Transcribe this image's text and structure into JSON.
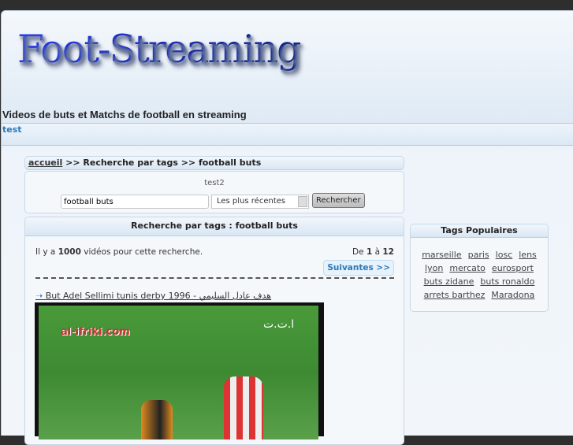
{
  "header": {
    "logo": "Foot-Streaming",
    "tagline": "Videos de buts et Matchs de football en streaming",
    "sub_link": "test"
  },
  "breadcrumb": {
    "home": "accueil",
    "rest": ">> Recherche par tags >> football buts"
  },
  "search": {
    "label": "test2",
    "query": "football buts",
    "sort": "Les plus récentes",
    "button": "Rechercher"
  },
  "results": {
    "title": "Recherche par tags : football buts",
    "count_prefix": "Il y a ",
    "count": "1000",
    "count_suffix": " vidéos pour cette recherche.",
    "range_prefix": "De ",
    "from": "1",
    "range_mid": " à ",
    "to": "12",
    "next": "Suivantes >>"
  },
  "video": {
    "title": "But Adel Sellimi tunis derby 1996 - هدف عادل السليمي",
    "watermark": "al-ifriki.com",
    "overlay": "ا.ت.ت"
  },
  "tags": {
    "title": "Tags Populaires",
    "items": [
      "marseille",
      "paris",
      "losc",
      "lens",
      "lyon",
      "mercato",
      "eurosport",
      "buts zidane",
      "buts ronaldo",
      "arrets barthez",
      "Maradona"
    ]
  }
}
